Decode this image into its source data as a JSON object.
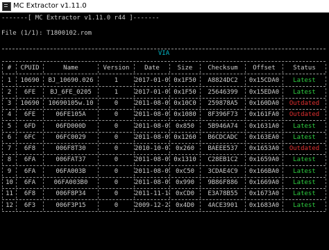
{
  "window": {
    "title": "MC Extractor v1.11.0"
  },
  "banner": "-------[ MC Extractor v1.11.0 r44 ]-------",
  "file_line": "File (1/1): T1800102.rom",
  "table": {
    "title": "VIA",
    "columns": [
      "#",
      "CPUID",
      "Name",
      "Version",
      "Date",
      "Size",
      "Checksum",
      "Offset",
      "Status"
    ],
    "rows": [
      [
        "1",
        "10690",
        "BJ_10690.026",
        "1",
        "2017-01-09",
        "0x1F50",
        "A8824DC2",
        "0x15CDA0",
        "Latest"
      ],
      [
        "2",
        "6FE",
        "BJ_6FE_0205",
        "1",
        "2017-01-09",
        "0x1F50",
        "25646399",
        "0x15EDA0",
        "Latest"
      ],
      [
        "3",
        "10690",
        "10690105w.10",
        "0",
        "2011-08-09",
        "0x10C0",
        "259878A5",
        "0x160DA0",
        "Outdated"
      ],
      [
        "4",
        "6FE",
        "06FE105A",
        "0",
        "2011-08-09",
        "0x1080",
        "8F396F73",
        "0x161FA0",
        "Outdated"
      ],
      [
        "5",
        "6FD",
        "06FD000D",
        "0",
        "2011-08-09",
        "0x850",
        "5B946A74",
        "0x1631A0",
        "Latest"
      ],
      [
        "6",
        "6FC",
        "06FC0029",
        "0",
        "2011-08-09",
        "0x1260",
        "B6CDCADC",
        "0x163EA0",
        "Latest"
      ],
      [
        "7",
        "6F8",
        "006F8T30",
        "0",
        "2010-10-07",
        "0x260",
        "BAEEE537",
        "0x1653A0",
        "Outdated"
      ],
      [
        "8",
        "6FA",
        "006FAT37",
        "0",
        "2011-08-09",
        "0x1310",
        "C28EB1C2",
        "0x1659A0",
        "Latest"
      ],
      [
        "9",
        "6FA",
        "06FA003B",
        "0",
        "2011-08-09",
        "0xC50",
        "3CDAE4C9",
        "0x166BA0",
        "Latest"
      ],
      [
        "10",
        "6FA",
        "06FA003B0",
        "0",
        "2011-08-09",
        "0x990",
        "9B86F886",
        "0x1669A0",
        "Latest"
      ],
      [
        "11",
        "6F8",
        "006F8P34",
        "0",
        "2011-11-16",
        "0xCD0",
        "E3A78B55",
        "0x1673A0",
        "Latest"
      ],
      [
        "12",
        "6F3",
        "006F3P15",
        "0",
        "2009-12-28",
        "0x4D0",
        "4ACE3901",
        "0x1683A0",
        "Latest"
      ]
    ],
    "status_colors": {
      "Latest": "#2ecc40",
      "Outdated": "#e03030"
    }
  }
}
